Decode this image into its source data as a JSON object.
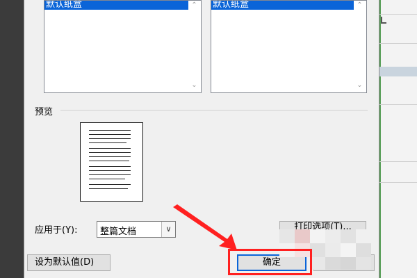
{
  "dialog": {
    "left_list": {
      "selected": "默认纸盒"
    },
    "right_list": {
      "selected": "默认纸盒"
    },
    "preview": {
      "section_label": "预览"
    },
    "apply_to": {
      "label": "应用于(Y):",
      "value": "整篇文档"
    },
    "buttons": {
      "set_default": "设为默认值(D)",
      "print_options": "打印选项(T)...",
      "ok": "确定",
      "cancel": ""
    }
  },
  "annotation": {
    "color": "#ff2020"
  }
}
